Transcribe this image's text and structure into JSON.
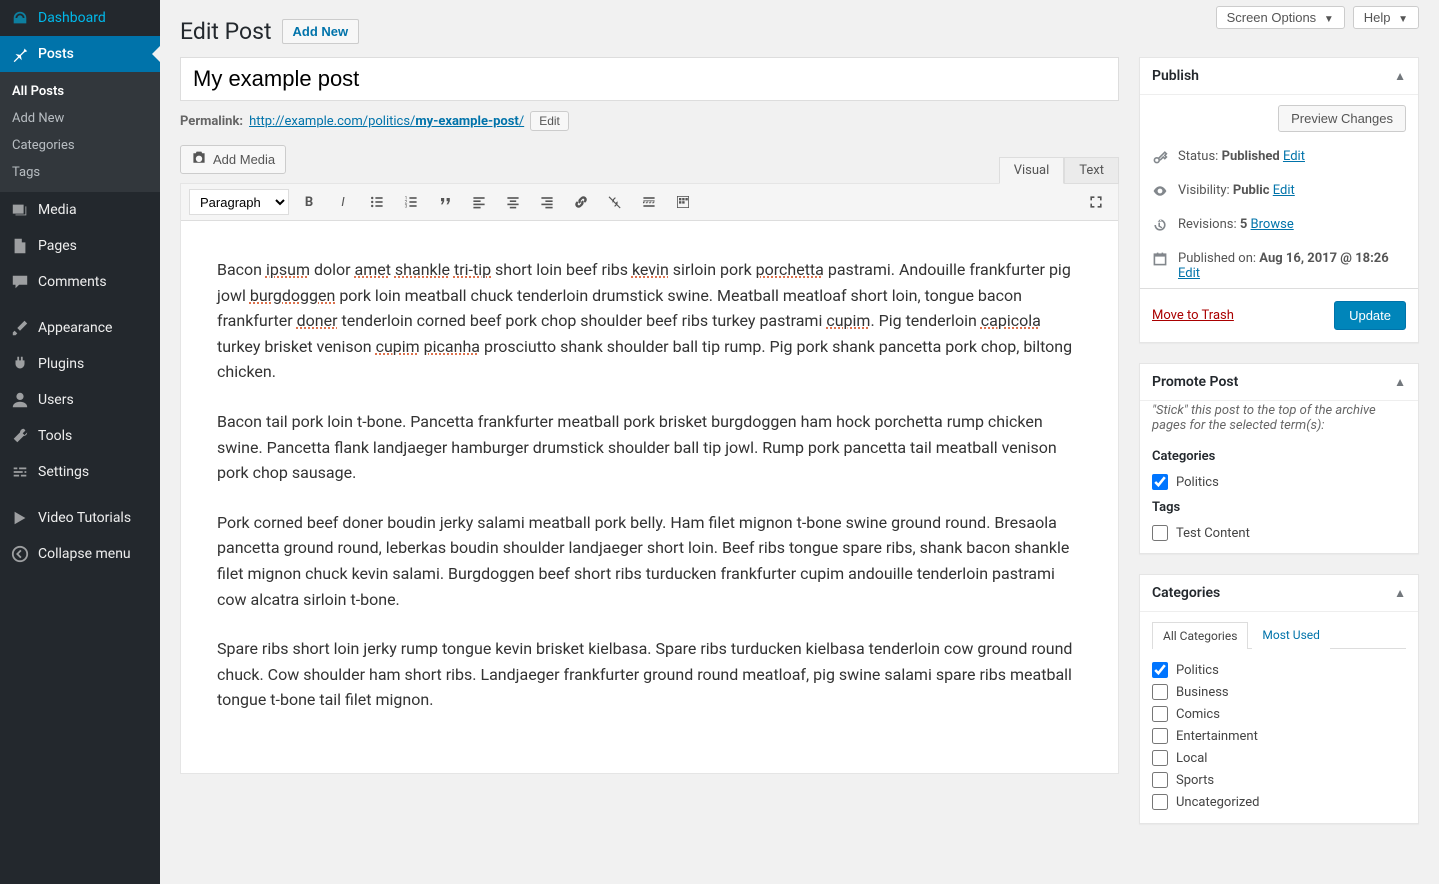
{
  "top": {
    "screen_options": "Screen Options",
    "help": "Help"
  },
  "sidebar": {
    "dashboard": "Dashboard",
    "posts": "Posts",
    "posts_sub": [
      "All Posts",
      "Add New",
      "Categories",
      "Tags"
    ],
    "media": "Media",
    "pages": "Pages",
    "comments": "Comments",
    "appearance": "Appearance",
    "plugins": "Plugins",
    "users": "Users",
    "tools": "Tools",
    "settings": "Settings",
    "video_tutorials": "Video Tutorials",
    "collapse": "Collapse menu"
  },
  "heading": "Edit Post",
  "add_new": "Add New",
  "post_title": "My example post",
  "permalink": {
    "label": "Permalink:",
    "base": "http://example.com/politics/",
    "slug": "my-example-post",
    "edit": "Edit"
  },
  "media_button": "Add Media",
  "editor_tabs": {
    "visual": "Visual",
    "text": "Text"
  },
  "format_select": "Paragraph",
  "content": {
    "p1_parts": [
      {
        "t": "Bacon "
      },
      {
        "t": "ipsum",
        "r": true
      },
      {
        "t": " dolor "
      },
      {
        "t": "amet",
        "r": true
      },
      {
        "t": " "
      },
      {
        "t": "shankle",
        "r": true
      },
      {
        "t": " "
      },
      {
        "t": "tri-tip",
        "r": true
      },
      {
        "t": " short loin beef ribs "
      },
      {
        "t": "kevin",
        "r": true
      },
      {
        "t": " sirloin pork "
      },
      {
        "t": "porchetta",
        "r": true
      },
      {
        "t": " pastrami. Andouille frankfurter pig jowl "
      },
      {
        "t": "burgdoggen",
        "r": true
      },
      {
        "t": " pork loin meatball chuck tenderloin drumstick swine. Meatball meatloaf short loin, tongue bacon frankfurter "
      },
      {
        "t": "doner",
        "r": true
      },
      {
        "t": " tenderloin corned beef pork chop shoulder beef ribs turkey pastrami "
      },
      {
        "t": "cupim",
        "r": true
      },
      {
        "t": ". Pig tenderloin "
      },
      {
        "t": "capicola",
        "r": true
      },
      {
        "t": " turkey brisket venison "
      },
      {
        "t": "cupim",
        "r": true
      },
      {
        "t": " "
      },
      {
        "t": "picanha",
        "r": true
      },
      {
        "t": " prosciutto shank shoulder ball tip rump. Pig pork shank pancetta pork chop, biltong chicken."
      }
    ],
    "p2": "Bacon tail pork loin t-bone. Pancetta frankfurter meatball pork brisket burgdoggen ham hock porchetta rump chicken swine. Pancetta flank landjaeger hamburger drumstick shoulder ball tip jowl. Rump pork pancetta tail meatball venison pork chop sausage.",
    "p3": "Pork corned beef doner boudin jerky salami meatball pork belly. Ham filet mignon t-bone swine ground round. Bresaola pancetta ground round, leberkas boudin shoulder landjaeger short loin. Beef ribs tongue spare ribs, shank bacon shankle filet mignon chuck kevin salami. Burgdoggen beef short ribs turducken frankfurter cupim andouille tenderloin pastrami cow alcatra sirloin t-bone.",
    "p4": "Spare ribs short loin jerky rump tongue kevin brisket kielbasa. Spare ribs turducken kielbasa tenderloin cow ground round chuck. Cow shoulder ham short ribs. Landjaeger frankfurter ground round meatloaf, pig swine salami spare ribs meatball tongue t-bone tail filet mignon."
  },
  "publish": {
    "title": "Publish",
    "preview": "Preview Changes",
    "status_label": "Status:",
    "status_value": "Published",
    "visibility_label": "Visibility:",
    "visibility_value": "Public",
    "revisions_label": "Revisions:",
    "revisions_count": "5",
    "browse": "Browse",
    "published_label": "Published on:",
    "published_value": "Aug 16, 2017 @ 18:26",
    "edit": "Edit",
    "trash": "Move to Trash",
    "update": "Update"
  },
  "promote": {
    "title": "Promote Post",
    "help": "\"Stick\" this post to the top of the archive pages for the selected term(s):",
    "categories_label": "Categories",
    "categories": [
      {
        "name": "Politics",
        "checked": true
      }
    ],
    "tags_label": "Tags",
    "tags": [
      {
        "name": "Test Content",
        "checked": false
      }
    ]
  },
  "categories_box": {
    "title": "Categories",
    "tab_all": "All Categories",
    "tab_most": "Most Used",
    "items": [
      {
        "name": "Politics",
        "checked": true
      },
      {
        "name": "Business",
        "checked": false
      },
      {
        "name": "Comics",
        "checked": false
      },
      {
        "name": "Entertainment",
        "checked": false
      },
      {
        "name": "Local",
        "checked": false
      },
      {
        "name": "Sports",
        "checked": false
      },
      {
        "name": "Uncategorized",
        "checked": false
      }
    ]
  }
}
